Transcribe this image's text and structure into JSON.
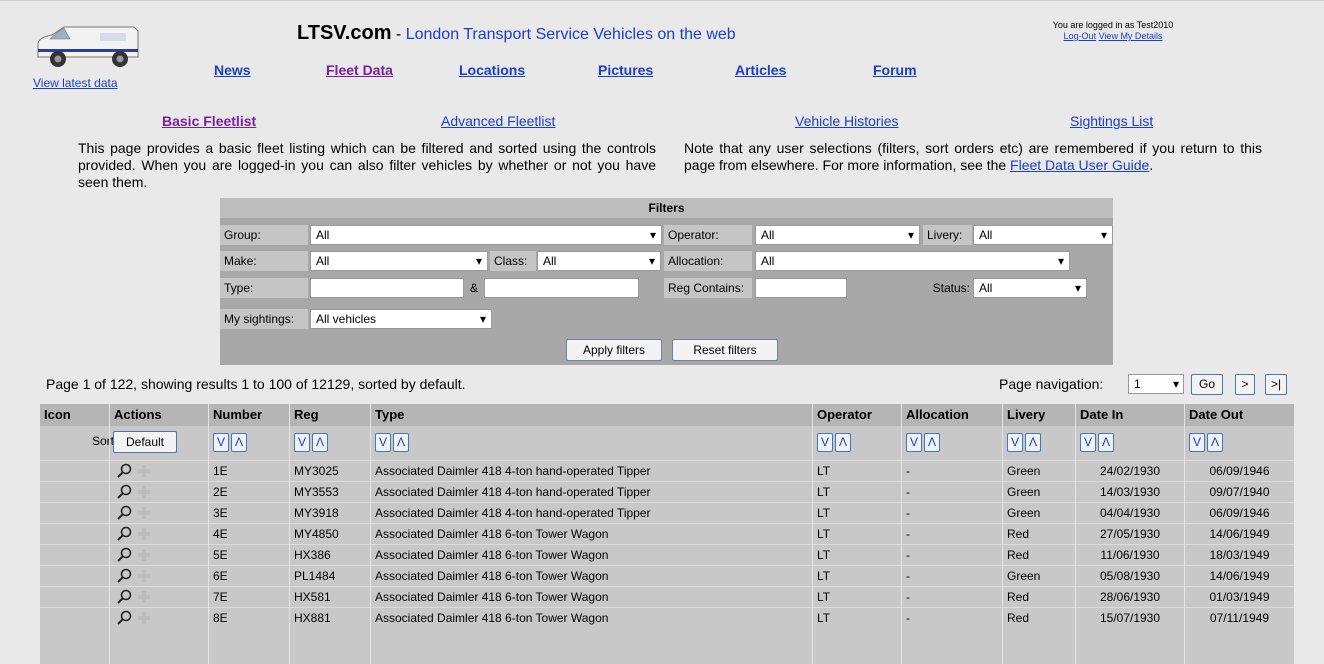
{
  "header": {
    "site_name": "LTSV.com",
    "separator": " - ",
    "subtitle": "London Transport Service Vehicles on the web",
    "view_latest": "View latest data",
    "login_status": "You are logged in as Test2010",
    "logout": "Log-Out",
    "view_details": "View My Details"
  },
  "nav": [
    "News",
    "Fleet Data",
    "Locations",
    "Pictures",
    "Articles",
    "Forum"
  ],
  "nav_active": "Fleet Data",
  "subnav": [
    "Basic Fleetlist",
    "Advanced Fleetlist",
    "Vehicle Histories",
    "Sightings List"
  ],
  "subnav_active": "Basic Fleetlist",
  "intro": {
    "left": "This page provides a basic fleet listing which can be filtered and sorted using the controls provided. When you are logged-in you can also filter vehicles by whether or not you have seen them.",
    "right_text": "Note that any user selections (filters, sort orders etc) are remembered if you return to this page from elsewhere. For more information, see the ",
    "right_link": "Fleet Data User Guide",
    "right_end": "."
  },
  "filters": {
    "title": "Filters",
    "group_label": "Group:",
    "group_value": "All",
    "operator_label": "Operator:",
    "operator_value": "All",
    "livery_label": "Livery:",
    "livery_value": "All",
    "make_label": "Make:",
    "make_value": "All",
    "class_label": "Class:",
    "class_value": "All",
    "allocation_label": "Allocation:",
    "allocation_value": "All",
    "type_label": "Type:",
    "type_amp": "&",
    "type_value_1": "",
    "type_value_2": "",
    "reg_label": "Reg Contains:",
    "reg_value": "",
    "status_label": "Status:",
    "status_value": "All",
    "sightings_label": "My sightings:",
    "sightings_value": "All vehicles",
    "apply": "Apply filters",
    "reset": "Reset filters"
  },
  "paging": {
    "info": "Page 1 of 122, showing results 1 to 100 of 12129, sorted by default.",
    "nav_label": "Page navigation:",
    "current_page": "1",
    "go": "Go",
    "next": ">",
    "last": ">|"
  },
  "table": {
    "columns": [
      "Icon",
      "Actions",
      "Number",
      "Reg",
      "Type",
      "Operator",
      "Allocation",
      "Livery",
      "Date In",
      "Date Out"
    ],
    "sort_label": "Sort:",
    "sort_default": "Default",
    "sort_desc": "V",
    "sort_asc": "Λ",
    "rows": [
      {
        "number": "1E",
        "reg": "MY3025",
        "type": "Associated Daimler 418 4-ton hand-operated Tipper",
        "operator": "LT",
        "allocation": "-",
        "livery": "Green",
        "date_in": "24/02/1930",
        "date_out": "06/09/1946"
      },
      {
        "number": "2E",
        "reg": "MY3553",
        "type": "Associated Daimler 418 4-ton hand-operated Tipper",
        "operator": "LT",
        "allocation": "-",
        "livery": "Green",
        "date_in": "14/03/1930",
        "date_out": "09/07/1940"
      },
      {
        "number": "3E",
        "reg": "MY3918",
        "type": "Associated Daimler 418 4-ton hand-operated Tipper",
        "operator": "LT",
        "allocation": "-",
        "livery": "Green",
        "date_in": "04/04/1930",
        "date_out": "06/09/1946"
      },
      {
        "number": "4E",
        "reg": "MY4850",
        "type": "Associated Daimler 418 6-ton Tower Wagon",
        "operator": "LT",
        "allocation": "-",
        "livery": "Red",
        "date_in": "27/05/1930",
        "date_out": "14/06/1949"
      },
      {
        "number": "5E",
        "reg": "HX386",
        "type": "Associated Daimler 418 6-ton Tower Wagon",
        "operator": "LT",
        "allocation": "-",
        "livery": "Red",
        "date_in": "11/06/1930",
        "date_out": "18/03/1949"
      },
      {
        "number": "6E",
        "reg": "PL1484",
        "type": "Associated Daimler 418 6-ton Tower Wagon",
        "operator": "LT",
        "allocation": "-",
        "livery": "Green",
        "date_in": "05/08/1930",
        "date_out": "14/06/1949"
      },
      {
        "number": "7E",
        "reg": "HX581",
        "type": "Associated Daimler 418 6-ton Tower Wagon",
        "operator": "LT",
        "allocation": "-",
        "livery": "Red",
        "date_in": "28/06/1930",
        "date_out": "01/03/1949"
      },
      {
        "number": "8E",
        "reg": "HX881",
        "type": "Associated Daimler 418 6-ton Tower Wagon",
        "operator": "LT",
        "allocation": "-",
        "livery": "Red",
        "date_in": "15/07/1930",
        "date_out": "07/11/1949"
      }
    ]
  },
  "icons": [
    "view-icon",
    "add-icon",
    "van-logo"
  ],
  "colors": {
    "link": "#1a3fc8",
    "active_link": "#7b1fa2",
    "background": "#e9e9e9"
  }
}
